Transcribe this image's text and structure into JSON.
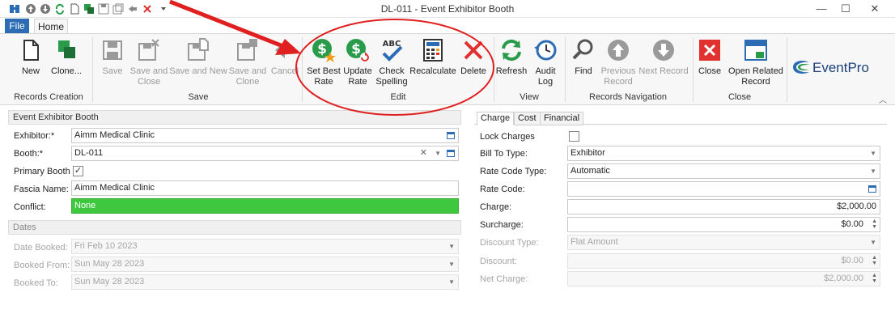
{
  "window": {
    "title": "DL-011 - Event Exhibitor Booth",
    "quick_access_icons": [
      "app-icon",
      "up-icon",
      "down-icon",
      "refresh-icon",
      "new-doc-icon",
      "clone-icon",
      "save-icon",
      "save-clone-icon",
      "undo-icon",
      "close-x-icon",
      "dropdown-icon"
    ],
    "controls": [
      "minimize-icon",
      "maximize-icon",
      "close-icon"
    ]
  },
  "ribbon_tabs": {
    "file": "File",
    "home": "Home"
  },
  "ribbon": {
    "groups": {
      "records_creation": "Records Creation",
      "save": "Save",
      "edit": "Edit",
      "view": "View",
      "records_navigation": "Records Navigation",
      "close": "Close"
    },
    "buttons": {
      "new": "New",
      "clone_line1": "Clone...",
      "save": "Save",
      "save_close_1": "Save and",
      "save_close_2": "Close",
      "save_new": "Save and New",
      "save_clone_1": "Save and",
      "save_clone_2": "Clone",
      "cancel": "Cancel",
      "set_best_rate_1": "Set Best",
      "set_best_rate_2": "Rate",
      "update_rate_1": "Update",
      "update_rate_2": "Rate",
      "check_spelling_1": "Check",
      "check_spelling_2": "Spelling",
      "recalculate": "Recalculate",
      "delete": "Delete",
      "refresh": "Refresh",
      "audit_log_1": "Audit",
      "audit_log_2": "Log",
      "find": "Find",
      "previous_record_1": "Previous",
      "previous_record_2": "Record",
      "next_record": "Next Record",
      "close": "Close",
      "open_related_1": "Open Related",
      "open_related_2": "Record"
    },
    "abc_label": "ABC",
    "logo_text": "EventPro"
  },
  "left_panel": {
    "header": "Event Exhibitor Booth",
    "fields": {
      "exhibitor_label": "Exhibitor:*",
      "exhibitor_value": "Aimm Medical Clinic",
      "booth_label": "Booth:*",
      "booth_value": "DL-011",
      "primary_booth_label": "Primary Booth",
      "primary_booth_checked": true,
      "fascia_label": "Fascia Name:",
      "fascia_value": "Aimm Medical Clinic",
      "conflict_label": "Conflict:",
      "conflict_value": "None"
    },
    "dates_header": "Dates",
    "dates": {
      "date_booked_label": "Date Booked:",
      "date_booked_value": "Fri Feb 10 2023",
      "booked_from_label": "Booked From:",
      "booked_from_value": "Sun May 28 2023",
      "booked_to_label": "Booked To:",
      "booked_to_value": "Sun May 28 2023"
    }
  },
  "right_panel": {
    "tabs": [
      "Charge",
      "Cost",
      "Financial"
    ],
    "fields": {
      "lock_charges_label": "Lock Charges",
      "lock_charges_checked": false,
      "bill_to_type_label": "Bill To Type:",
      "bill_to_type_value": "Exhibitor",
      "rate_code_type_label": "Rate Code Type:",
      "rate_code_type_value": "Automatic",
      "rate_code_label": "Rate Code:",
      "rate_code_value": "",
      "charge_label": "Charge:",
      "charge_value": "$2,000.00",
      "surcharge_label": "Surcharge:",
      "surcharge_value": "$0.00",
      "discount_type_label": "Discount Type:",
      "discount_type_value": "Flat Amount",
      "discount_label": "Discount:",
      "discount_value": "$0.00",
      "net_charge_label": "Net Charge:",
      "net_charge_value": "$2,000.00"
    }
  },
  "colors": {
    "accent_blue": "#2b6cb5",
    "green_dollar": "#2a9b4a",
    "delete_red": "#e03030",
    "conflict_green": "#3fc73f",
    "annotation_red": "#e02020"
  }
}
